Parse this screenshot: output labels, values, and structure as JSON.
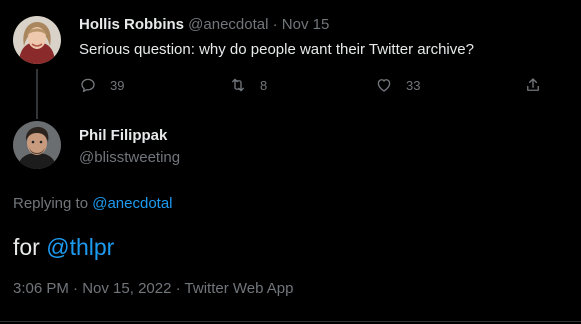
{
  "parent_tweet": {
    "display_name": "Hollis Robbins",
    "handle": "@anecdotal",
    "separator": "·",
    "date": "Nov 15",
    "text": "Serious question: why do people want their Twitter archive?",
    "avatar_icon": "avatar-hollis",
    "actions": {
      "reply": {
        "icon": "reply-icon",
        "count": "39"
      },
      "retweet": {
        "icon": "retweet-icon",
        "count": "8"
      },
      "like": {
        "icon": "heart-icon",
        "count": "33"
      },
      "share": {
        "icon": "share-icon"
      }
    }
  },
  "main_tweet": {
    "display_name": "Phil Filippak",
    "handle": "@blisstweeting",
    "avatar_icon": "avatar-phil",
    "replying_to_prefix": "Replying to",
    "replying_to_handle": "@anecdotal",
    "text_prefix": "for",
    "text_mention": "@thlpr",
    "time": "3:06 PM",
    "date": "Nov 15, 2022",
    "source": "Twitter Web App",
    "meta_separator": "·"
  },
  "colors": {
    "background": "#000000",
    "primary_text": "#e7e9ea",
    "secondary_text": "#71767b",
    "link": "#1d9bf0",
    "thread_line": "#333639"
  }
}
